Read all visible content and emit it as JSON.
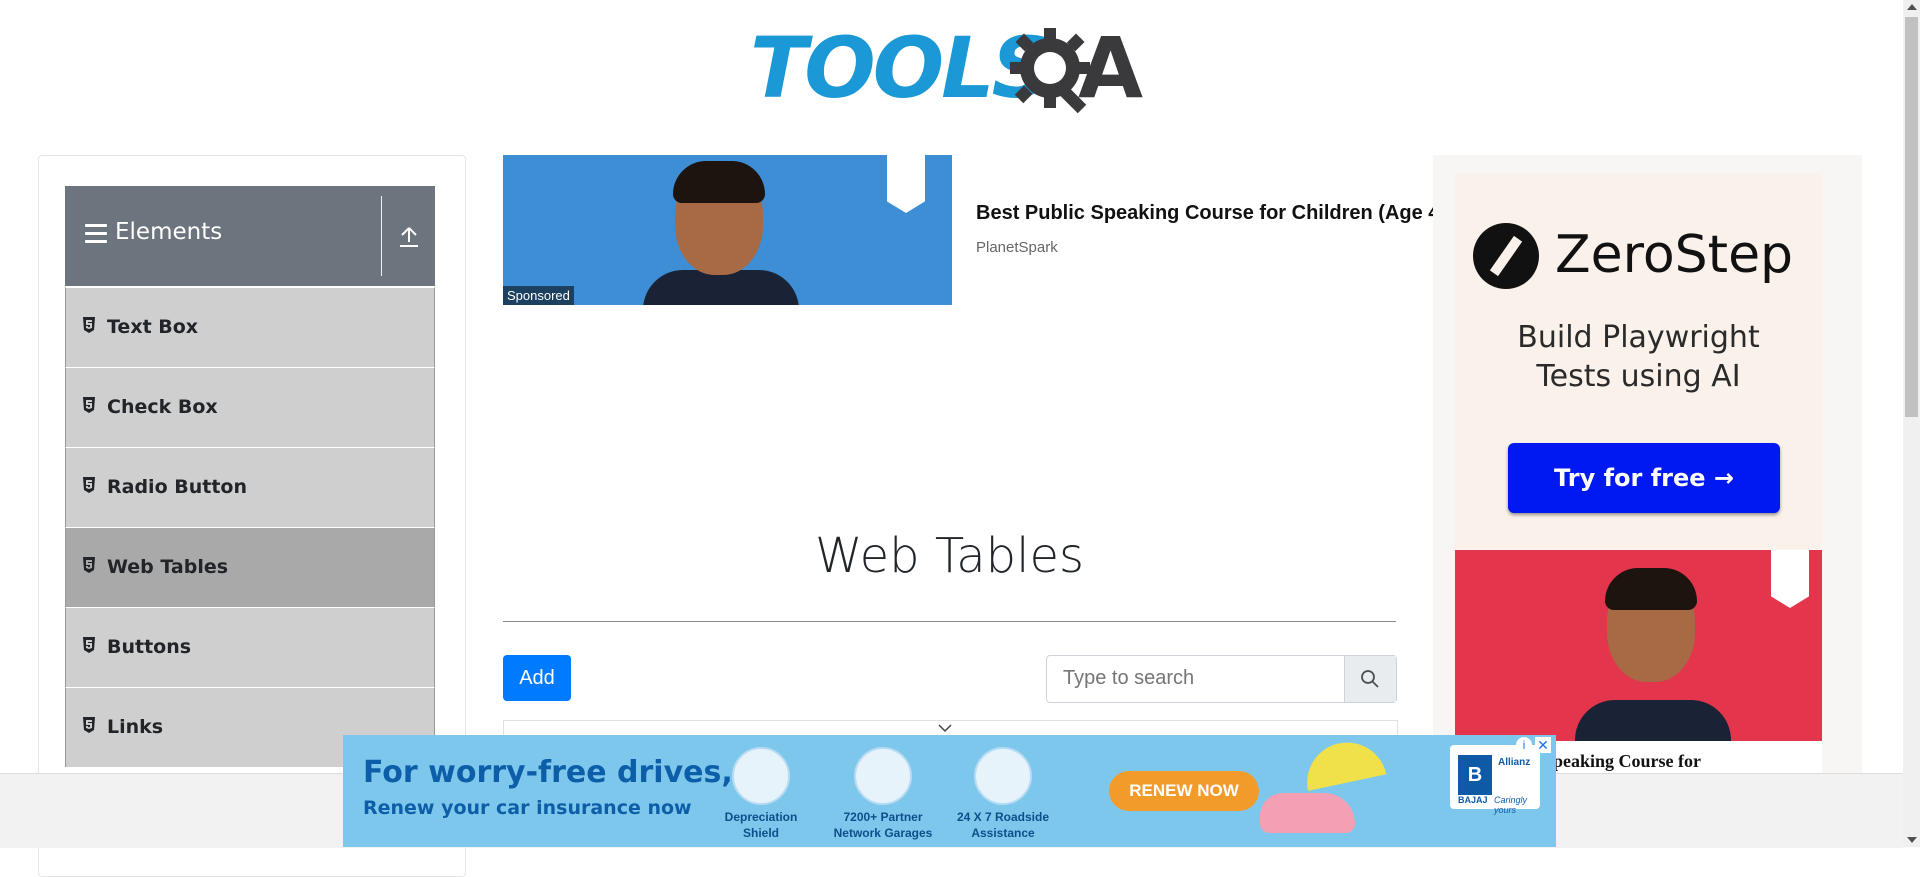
{
  "header": {
    "logo_text_left": "TOOLS",
    "logo_text_right": "A"
  },
  "sidebar": {
    "group_title": "Elements",
    "items": [
      {
        "label": "Text Box",
        "active": false
      },
      {
        "label": "Check Box",
        "active": false
      },
      {
        "label": "Radio Button",
        "active": false
      },
      {
        "label": "Web Tables",
        "active": true
      },
      {
        "label": "Buttons",
        "active": false
      },
      {
        "label": "Links",
        "active": false
      }
    ]
  },
  "sponsored_ad": {
    "tag": "Sponsored",
    "title": "Best Public Speaking Course for Children (Age 4",
    "source": "PlanetSpark"
  },
  "main": {
    "title": "Web Tables",
    "add_label": "Add",
    "search": {
      "placeholder": "Type to search",
      "value": ""
    }
  },
  "right_ad": {
    "brand": "ZeroStep",
    "tagline_1": "Build Playwright",
    "tagline_2": "Tests using AI",
    "cta": "Try for free →",
    "second_ad_text": "Speaking Course for"
  },
  "bottom_ad": {
    "line1": "For worry-free drives,",
    "line2": "Renew your car insurance now",
    "features": [
      {
        "l1": "Depreciation",
        "l2": "Shield"
      },
      {
        "l1": "7200+ Partner",
        "l2": "Network Garages"
      },
      {
        "l1": "24 X 7 Roadside",
        "l2": "Assistance"
      }
    ],
    "cta": "RENEW NOW",
    "partner": "Allianz",
    "brand_mark": "B",
    "brand_sub": "BAJAJ",
    "brand_slogan": "Caringly yours",
    "info_icon": "i",
    "close_icon": "✕"
  },
  "colors": {
    "accent": "#007bff",
    "sidebar_header": "#6c757d",
    "logo_blue": "#1b98d6",
    "zerostep_cta": "#0019f0"
  }
}
